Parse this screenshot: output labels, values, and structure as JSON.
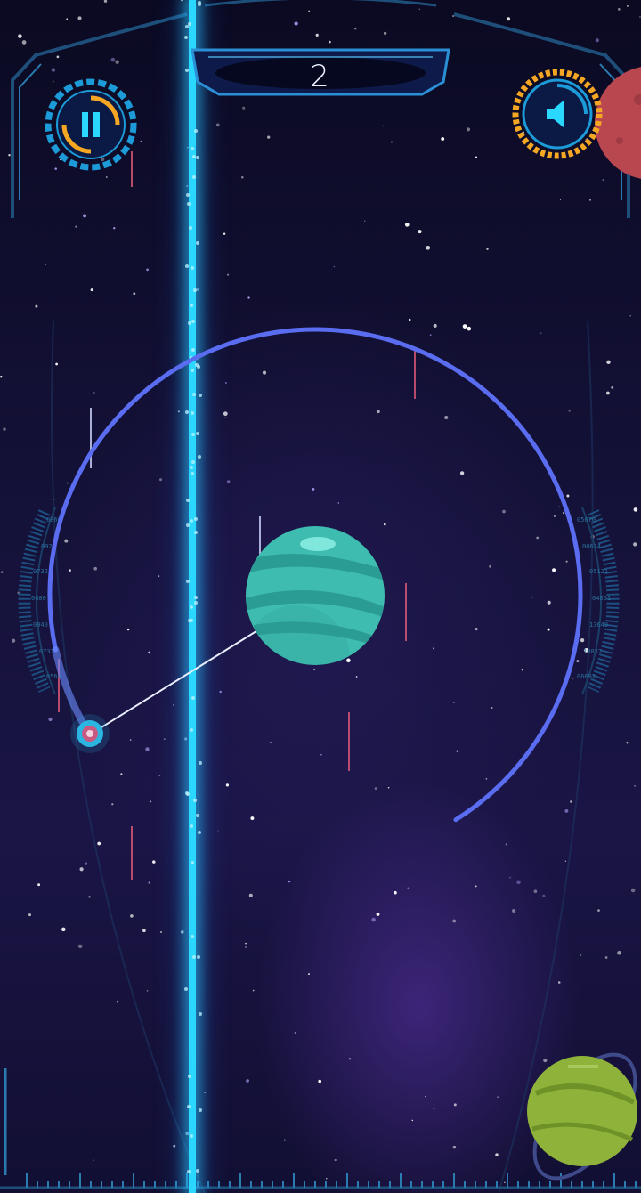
{
  "game": {
    "score": "2"
  },
  "hud": {
    "pause_icon": "pause-icon",
    "sound_icon": "speaker-icon",
    "accent_cyan": "#2ad8ff",
    "accent_orange": "#f5a623",
    "orbit_color": "#5a6cf0"
  },
  "side_gauge_left": {
    "readouts": [
      "0860",
      "0920",
      "0732",
      "0880",
      "0940",
      "0732",
      "0560"
    ]
  },
  "side_gauge_right": {
    "readouts": [
      "05670",
      "00634",
      "05121",
      "04861",
      "13640",
      "10837",
      "06692"
    ]
  }
}
